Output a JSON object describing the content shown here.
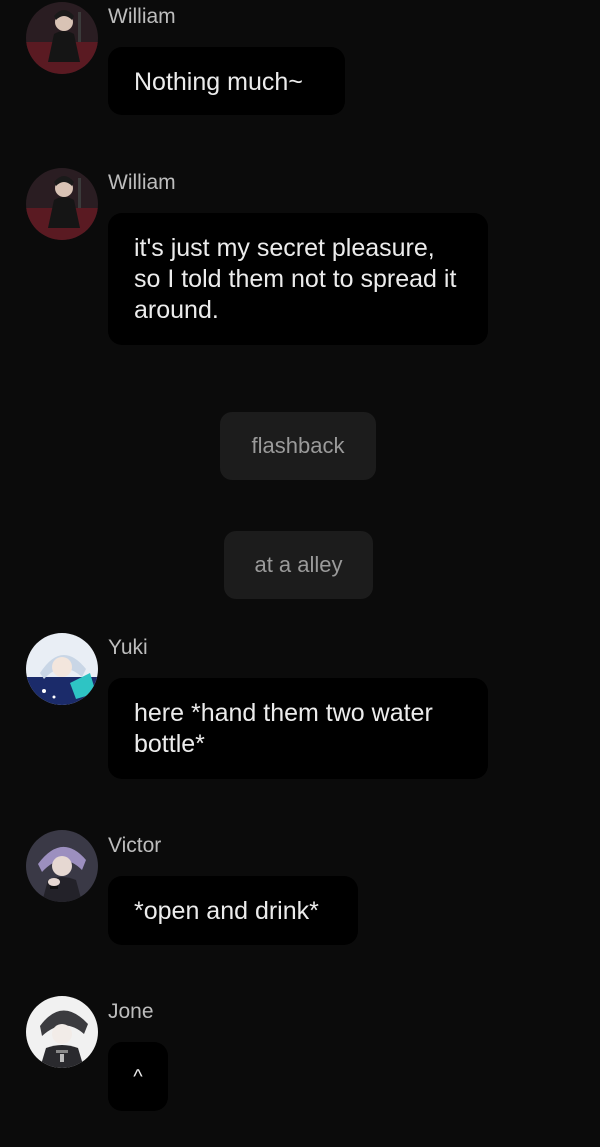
{
  "messages": [
    {
      "type": "user",
      "sender": "William",
      "avatar": "william-avatar",
      "text": "Nothing much~"
    },
    {
      "type": "user",
      "sender": "William",
      "avatar": "william-avatar",
      "text": "it's just my secret pleasure, so I told them not to spread it around."
    },
    {
      "type": "system",
      "text": "flashback"
    },
    {
      "type": "system",
      "text": "at a alley"
    },
    {
      "type": "user",
      "sender": "Yuki",
      "avatar": "yuki-avatar",
      "text": "here *hand them two water bottle*"
    },
    {
      "type": "user",
      "sender": "Victor",
      "avatar": "victor-avatar",
      "text": "*open and drink*"
    },
    {
      "type": "user",
      "sender": "Jone",
      "avatar": "jone-avatar",
      "text": "^"
    }
  ],
  "colors": {
    "background": "#0b0b0b",
    "bubble": "#000000",
    "system_bubble": "#1c1c1c",
    "sender_text": "#bdbdbd",
    "message_text": "#ececec",
    "system_text": "#9a9a9a"
  }
}
